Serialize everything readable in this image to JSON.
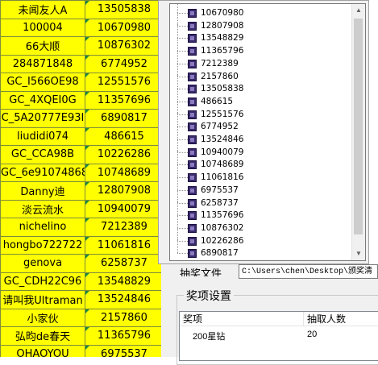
{
  "sheet": {
    "rows": [
      {
        "name": "未闻友人A",
        "id": "13505838"
      },
      {
        "name": "100004",
        "id": "10670980"
      },
      {
        "name": "66大顺",
        "id": "10876302"
      },
      {
        "name": "284871848",
        "id": "6774952"
      },
      {
        "name": "GC_I566OE98",
        "id": "12551576"
      },
      {
        "name": "GC_4XQEI0G",
        "id": "11357696"
      },
      {
        "name": "C_5A20777E93I",
        "id": "6890817"
      },
      {
        "name": "liudidi074",
        "id": "486615"
      },
      {
        "name": "GC_CCA98B",
        "id": "10226286"
      },
      {
        "name": "GC_6e91074868",
        "id": "10748689"
      },
      {
        "name": "Danny迪",
        "id": "12807908"
      },
      {
        "name": "淡云流水",
        "id": "10940079"
      },
      {
        "name": "nichelino",
        "id": "7212389"
      },
      {
        "name": "hongbo722722",
        "id": "11061816"
      },
      {
        "name": "genova",
        "id": "6258737"
      },
      {
        "name": "GC_CDH22C96",
        "id": "13548829"
      },
      {
        "name": "请叫我Ultraman",
        "id": "13524846"
      },
      {
        "name": "小家伙",
        "id": "2157860"
      },
      {
        "name": "弘昀de春天",
        "id": "11365796"
      },
      {
        "name": "OHAOYOU",
        "id": "6975537"
      }
    ]
  },
  "tree": {
    "items": [
      "10670980",
      "12807908",
      "13548829",
      "11365796",
      "7212389",
      "2157860",
      "13505838",
      "486615",
      "12551576",
      "6774952",
      "13524846",
      "10940079",
      "10748689",
      "11061816",
      "6975537",
      "6258737",
      "11357696",
      "10876302",
      "10226286",
      "6890817"
    ]
  },
  "file": {
    "label": "抽奖文件",
    "path": "C:\\Users\\chen\\Desktop\\颁奖清"
  },
  "prize_group": {
    "title": "奖项设置",
    "col_prize": "奖项",
    "col_count": "抽取人数",
    "rows": [
      {
        "prize": "200星钻",
        "count": "20"
      }
    ]
  },
  "colors": {
    "sheet_bg": "#ffff00",
    "window_bg": "#f0f0f0",
    "icon": "#3a2a6a"
  }
}
